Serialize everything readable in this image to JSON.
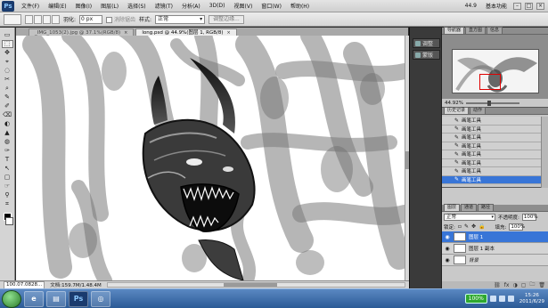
{
  "app": {
    "logo": "Ps"
  },
  "menu": [
    "文件(F)",
    "编辑(E)",
    "图像(I)",
    "图层(L)",
    "选择(S)",
    "滤镜(T)",
    "分析(A)",
    "3D(D)",
    "视图(V)",
    "窗口(W)",
    "帮助(H)"
  ],
  "menubar_right": {
    "zoom": "44.9",
    "workspace": "基本功能",
    "window_controls": [
      "–",
      "□",
      "×"
    ]
  },
  "options": {
    "feather_label": "羽化:",
    "feather_value": "0 px",
    "antialias_label": "消除锯齿",
    "style_label": "样式:",
    "style_value": "正常",
    "refine_button": "调整边缘..."
  },
  "tools": [
    "▭",
    "⬚",
    "✥",
    "⌖",
    "◌",
    "✂",
    "⌕",
    "✎",
    "✐",
    "⌫",
    "◐",
    "▲",
    "◍",
    "✑",
    "T",
    "↖",
    "▢",
    "☞",
    "⚲",
    "⌗"
  ],
  "doc_tabs": [
    {
      "label": "_IMG_1053(2).jpg @ 37.1%(RGB/8)",
      "close": "×"
    },
    {
      "label": "long.psd @ 44.9%(图层 1, RGB/8)",
      "close": "×"
    }
  ],
  "status": {
    "zoom": "100.07.0828...",
    "doc": "文档:159.7M/1.48.4M"
  },
  "dock": [
    {
      "label": "调整"
    },
    {
      "label": "蒙版"
    }
  ],
  "navigator": {
    "tabs": [
      "导航器",
      "直方图",
      "信息"
    ],
    "zoom": "44.92%"
  },
  "history": {
    "tabs": [
      "历史记录",
      "动作"
    ],
    "items": [
      "画笔工具",
      "画笔工具",
      "画笔工具",
      "画笔工具",
      "画笔工具",
      "画笔工具",
      "画笔工具",
      "画笔工具"
    ]
  },
  "layers": {
    "tabs": [
      "图层",
      "通道",
      "路径"
    ],
    "blend_mode": "正常",
    "opacity_label": "不透明度:",
    "opacity_value": "100%",
    "lock_label": "锁定:",
    "fill_label": "填充:",
    "fill_value": "100%",
    "items": [
      {
        "name": "图层 1",
        "active": true
      },
      {
        "name": "图层 1 副本",
        "active": false
      },
      {
        "name": "背景",
        "active": false
      }
    ],
    "footer_icons": [
      "⛓",
      "fx",
      "◑",
      "▢",
      "🗀",
      "🗑"
    ]
  },
  "taskbar": {
    "buttons": [
      "e",
      "▤",
      "Ps",
      "◎"
    ],
    "battery": "100%",
    "time": "15:26",
    "date": "2011/6/29"
  }
}
